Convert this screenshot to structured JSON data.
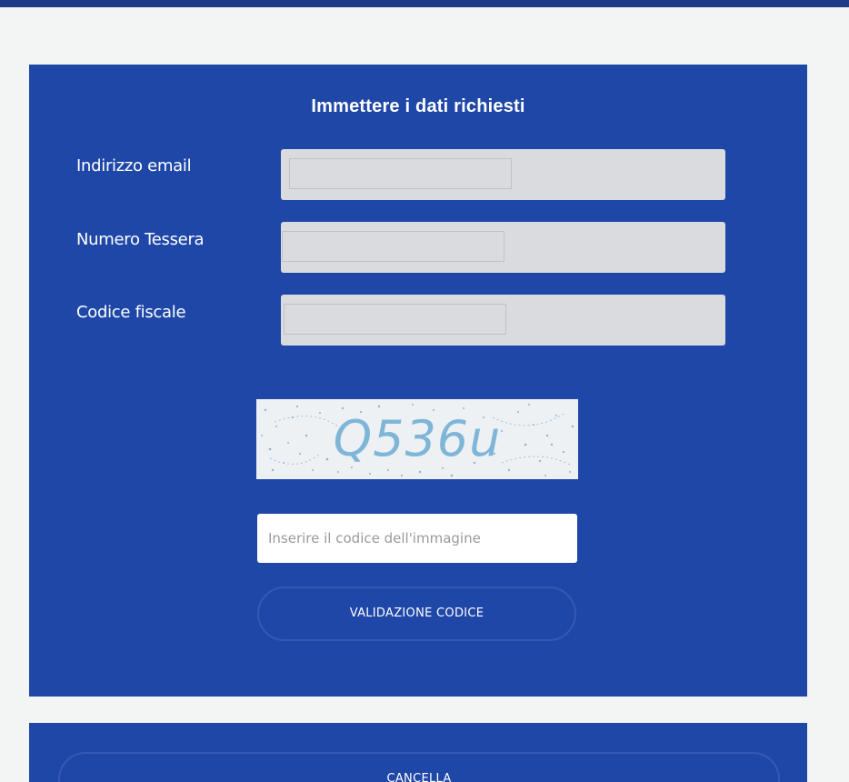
{
  "form": {
    "title": "Immettere i dati richiesti",
    "fields": [
      {
        "label": "Indirizzo email",
        "value": ""
      },
      {
        "label": "Numero Tessera",
        "value": ""
      },
      {
        "label": "Codice fiscale",
        "value": ""
      }
    ]
  },
  "captcha": {
    "code_text": "Q536u",
    "input_placeholder": "Inserire il codice dell'immagine",
    "validate_label": "VALIDAZIONE CODICE"
  },
  "footer": {
    "cancel_label": "CANCELLA"
  },
  "colors": {
    "panel": "#1f47a8",
    "background": "#f3f4f4",
    "field": "#d9dbde",
    "captcha_text": "#7fb6d8"
  }
}
